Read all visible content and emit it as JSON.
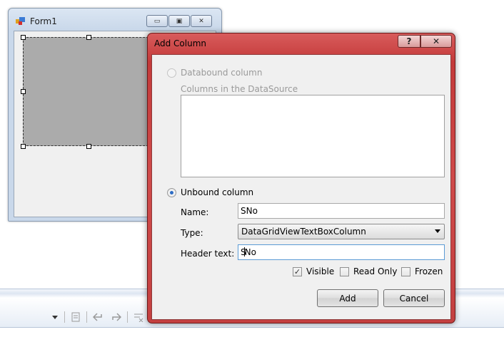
{
  "form1": {
    "title": "Form1",
    "minimize_glyph": "▭",
    "maximize_glyph": "▣",
    "close_glyph": "✕"
  },
  "dialog": {
    "title": "Add Column",
    "help_glyph": "?",
    "close_glyph": "✕",
    "databound_label": "Databound column",
    "datasource_label": "Columns in the DataSource",
    "unbound_label": "Unbound column",
    "name_label": "Name:",
    "name_value": "SNo",
    "type_label": "Type:",
    "type_value": "DataGridViewTextBoxColumn",
    "header_label": "Header text:",
    "header_value_before_caret": "S",
    "header_value_after_caret": "No",
    "visible_label": "Visible",
    "visible_checked": true,
    "readonly_label": "Read Only",
    "readonly_checked": false,
    "frozen_label": "Frozen",
    "frozen_checked": false,
    "add_label": "Add",
    "cancel_label": "Cancel",
    "check_glyph": "✓"
  },
  "toolbar": {
    "icons": [
      "dropdown-arrow-icon",
      "properties-icon",
      "undo-icon",
      "redo-icon",
      "clear-icon"
    ]
  },
  "colors": {
    "dialog_frame": "#c94444",
    "focus_border": "#5b9bd5",
    "grid_placeholder": "#ababab"
  }
}
